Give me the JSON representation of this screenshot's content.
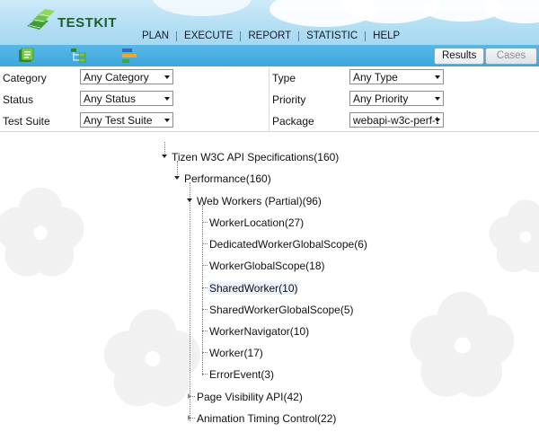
{
  "app": {
    "logo_text": "TESTKIT"
  },
  "nav": {
    "items": [
      "PLAN",
      "EXECUTE",
      "REPORT",
      "STATISTIC",
      "HELP"
    ]
  },
  "toolbar": {
    "icons": [
      "test-plan-icon",
      "tree-view-icon",
      "bar-chart-icon"
    ],
    "results_label": "Results",
    "cases_label": "Cases"
  },
  "filters": {
    "category": {
      "label": "Category",
      "value": "Any Category"
    },
    "type": {
      "label": "Type",
      "value": "Any Type"
    },
    "status": {
      "label": "Status",
      "value": "Any Status"
    },
    "priority": {
      "label": "Priority",
      "value": "Any Priority"
    },
    "test_suite": {
      "label": "Test Suite",
      "value": "Any Test Suite"
    },
    "package": {
      "label": "Package",
      "value": "webapi-w3c-perf-t"
    }
  },
  "tree": {
    "root": "Tizen W3C API Specifications(160)",
    "performance": "Performance(160)",
    "web_workers": "Web Workers (Partial)(96)",
    "leaves": [
      "WorkerLocation(27)",
      "DedicatedWorkerGlobalScope(6)",
      "WorkerGlobalScope(18)",
      "SharedWorker(10)",
      "SharedWorkerGlobalScope(5)",
      "WorkerNavigator(10)",
      "Worker(17)",
      "ErrorEvent(3)"
    ],
    "page_visibility": "Page Visibility API(42)",
    "animation_timing": "Animation Timing Control(22)",
    "selected": "SharedWorker(10)"
  },
  "colors": {
    "header_sky": "#b4dff4",
    "toolbar_blue": "#4aaee0",
    "logo_green": "#1f5d2c"
  }
}
